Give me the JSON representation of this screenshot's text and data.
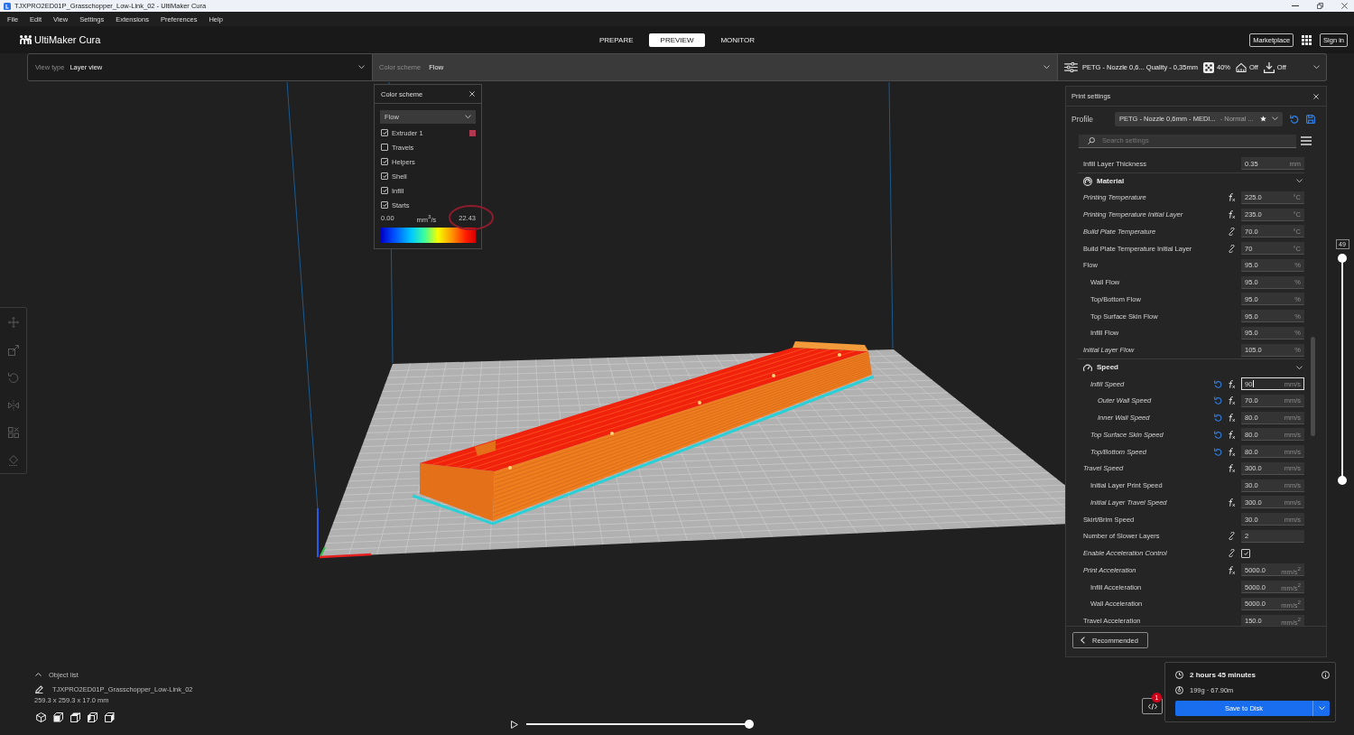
{
  "window": {
    "title": "TJXPRO2ED01P_Grasschopper_Low-Link_02 - UltiMaker Cura"
  },
  "menu": [
    "File",
    "Edit",
    "View",
    "Settings",
    "Extensions",
    "Preferences",
    "Help"
  ],
  "header": {
    "logo": "UltiMaker Cura",
    "stages": [
      {
        "label": "PREPARE",
        "selected": false
      },
      {
        "label": "PREVIEW",
        "selected": true
      },
      {
        "label": "MONITOR",
        "selected": false
      }
    ],
    "marketplace": "Marketplace",
    "sign_in": "Sign in"
  },
  "view_bar": {
    "view_type": {
      "label": "View type",
      "value": "Layer view"
    },
    "color_scheme": {
      "label": "Color scheme",
      "value": "Flow"
    },
    "print_setup": {
      "profile": "PETG - Nozzle 0,6... Quality - 0,35mm",
      "infill": "40%",
      "support": "Off",
      "adhesion": "Off"
    }
  },
  "color_scheme_panel": {
    "title": "Color scheme",
    "scheme": "Flow",
    "options": [
      {
        "label": "Extruder 1",
        "checked": true,
        "color": "#b0384f"
      },
      {
        "label": "Travels",
        "checked": false
      },
      {
        "label": "Helpers",
        "checked": true
      },
      {
        "label": "Shell",
        "checked": true
      },
      {
        "label": "Infill",
        "checked": true
      },
      {
        "label": "Starts",
        "checked": true
      }
    ],
    "legend": {
      "min": "0.00",
      "unit": "mm$^{3}$/s",
      "max": "22.43",
      "max_circled": true
    }
  },
  "tools": [
    {
      "kind": "move",
      "disabled": true
    },
    {
      "kind": "scale",
      "disabled": true
    },
    {
      "kind": "rotate",
      "disabled": true
    },
    {
      "kind": "mirror",
      "disabled": true
    },
    {
      "kind": "permodel",
      "disabled": true
    },
    {
      "kind": "blocker",
      "disabled": true
    }
  ],
  "print_settings": {
    "title": "Print settings",
    "profile_label": "Profile",
    "profile": "PETG - Nozzle 0,6mm - MEDI...",
    "profile_quality": "- Normal ...",
    "search_placeholder": "Search settings",
    "items": [
      {
        "kind": "setting",
        "label": "Infill Layer Thickness",
        "inherited": false,
        "modified": false,
        "formula": false,
        "linked": false,
        "value": "0.35",
        "unit": "mm",
        "focused": false
      },
      {
        "kind": "category",
        "label": "Material",
        "expanded": true,
        "children": [
          {
            "kind": "setting",
            "label": "Printing Temperature",
            "inherited": true,
            "modified": false,
            "formula": true,
            "linked": false,
            "value": "225.0",
            "unit": "°C",
            "focused": false
          },
          {
            "kind": "setting",
            "label": "Printing Temperature Initial Layer",
            "inherited": true,
            "modified": false,
            "formula": true,
            "linked": false,
            "value": "235.0",
            "unit": "°C",
            "focused": false
          },
          {
            "kind": "setting",
            "label": "Build Plate Temperature",
            "inherited": true,
            "modified": false,
            "formula": false,
            "linked": true,
            "value": "70.0",
            "unit": "°C",
            "focused": false
          },
          {
            "kind": "setting",
            "label": "Build Plate Temperature Initial Layer",
            "inherited": false,
            "modified": false,
            "formula": false,
            "linked": true,
            "value": "70",
            "unit": "°C",
            "focused": false
          },
          {
            "kind": "setting",
            "label": "Flow",
            "inherited": false,
            "modified": false,
            "formula": false,
            "linked": false,
            "value": "95.0",
            "unit": "%",
            "focused": false,
            "children": [
              {
                "kind": "setting",
                "label": "Wall Flow",
                "inherited": false,
                "modified": false,
                "formula": false,
                "linked": false,
                "value": "95.0",
                "unit": "%",
                "focused": false
              },
              {
                "kind": "setting",
                "label": "Top/Bottom Flow",
                "inherited": false,
                "modified": false,
                "formula": false,
                "linked": false,
                "value": "95.0",
                "unit": "%",
                "focused": false
              },
              {
                "kind": "setting",
                "label": "Top Surface Skin Flow",
                "inherited": false,
                "modified": false,
                "formula": false,
                "linked": false,
                "value": "95.0",
                "unit": "%",
                "focused": false
              },
              {
                "kind": "setting",
                "label": "Infill Flow",
                "inherited": false,
                "modified": false,
                "formula": false,
                "linked": false,
                "value": "95.0",
                "unit": "%",
                "focused": false
              }
            ]
          },
          {
            "kind": "setting",
            "label": "Initial Layer Flow",
            "inherited": true,
            "modified": false,
            "formula": false,
            "linked": false,
            "value": "105.0",
            "unit": "%",
            "focused": false
          }
        ]
      },
      {
        "kind": "category",
        "label": "Speed",
        "expanded": true,
        "children": [
          {
            "kind": "group",
            "children": [
              {
                "kind": "setting",
                "label": "Infill Speed",
                "inherited": true,
                "modified": true,
                "formula": true,
                "linked": false,
                "value": "90",
                "unit": "mm/s",
                "focused": true
              },
              {
                "kind": "group",
                "children": [
                  {
                    "kind": "setting",
                    "label": "Outer Wall Speed",
                    "inherited": true,
                    "modified": true,
                    "formula": true,
                    "linked": false,
                    "value": "70.0",
                    "unit": "mm/s",
                    "focused": false
                  },
                  {
                    "kind": "setting",
                    "label": "Inner Wall Speed",
                    "inherited": true,
                    "modified": true,
                    "formula": true,
                    "linked": false,
                    "value": "80.0",
                    "unit": "mm/s",
                    "focused": false
                  }
                ]
              },
              {
                "kind": "setting",
                "label": "Top Surface Skin Speed",
                "inherited": true,
                "modified": true,
                "formula": true,
                "linked": false,
                "value": "80.0",
                "unit": "mm/s",
                "focused": false
              },
              {
                "kind": "setting",
                "label": "Top/Bottom Speed",
                "inherited": true,
                "modified": true,
                "formula": true,
                "linked": false,
                "value": "80.0",
                "unit": "mm/s",
                "focused": false
              }
            ]
          },
          {
            "kind": "setting",
            "label": "Travel Speed",
            "inherited": true,
            "modified": false,
            "formula": true,
            "linked": false,
            "value": "300.0",
            "unit": "mm/s",
            "focused": false
          },
          {
            "kind": "group",
            "children": [
              {
                "kind": "setting",
                "label": "Initial Layer Print Speed",
                "inherited": false,
                "modified": false,
                "formula": false,
                "linked": false,
                "value": "30.0",
                "unit": "mm/s",
                "focused": false
              },
              {
                "kind": "setting",
                "label": "Initial Layer Travel Speed",
                "inherited": true,
                "modified": false,
                "formula": true,
                "linked": false,
                "value": "300.0",
                "unit": "mm/s",
                "focused": false
              }
            ]
          },
          {
            "kind": "setting",
            "label": "Skirt/Brim Speed",
            "inherited": false,
            "modified": false,
            "formula": false,
            "linked": false,
            "value": "30.0",
            "unit": "mm/s",
            "focused": false
          },
          {
            "kind": "setting",
            "label": "Number of Slower Layers",
            "inherited": false,
            "modified": false,
            "formula": false,
            "linked": true,
            "value": "2",
            "focused": false
          },
          {
            "kind": "checkbox",
            "label": "Enable Acceleration Control",
            "inherited": true,
            "modified": false,
            "formula": false,
            "linked": true,
            "checked": true
          },
          {
            "kind": "setting",
            "label": "Print Acceleration",
            "inherited": true,
            "modified": false,
            "formula": true,
            "linked": false,
            "value": "5000.0",
            "unit": "mm/s$^{2}$",
            "focused": false,
            "children": [
              {
                "kind": "setting",
                "label": "Infill Acceleration",
                "inherited": false,
                "modified": false,
                "formula": false,
                "linked": false,
                "value": "5000.0",
                "unit": "mm/s$^{2}$",
                "focused": false
              },
              {
                "kind": "setting",
                "label": "Wall Acceleration",
                "inherited": false,
                "modified": false,
                "formula": false,
                "linked": false,
                "value": "5000.0",
                "unit": "mm/s$^{2}$",
                "focused": false
              }
            ]
          },
          {
            "kind": "setting",
            "label": "Travel Acceleration",
            "inherited": false,
            "modified": false,
            "formula": false,
            "linked": false,
            "value": "150.0",
            "unit": "mm/s$^{2}$",
            "focused": false
          }
        ]
      }
    ],
    "recommended": "Recommended"
  },
  "layer_slider": {
    "label": "49",
    "top_handle": {
      "level": 1
    },
    "bottom_handle": {
      "level": 0
    }
  },
  "object_list": {
    "title": "Object list",
    "object": "TJXPRO2ED01P_Grasschopper_Low-Link_02",
    "dimensions": "259.3 x 259.3 x 17.0 mm",
    "views": [
      {
        "kind": "perspective"
      },
      {
        "kind": "front"
      },
      {
        "kind": "top"
      },
      {
        "kind": "left"
      },
      {
        "kind": "right"
      }
    ]
  },
  "playback": {
    "level": 1
  },
  "notifications": {
    "badge": "1"
  },
  "print_info": {
    "time": "2 hours 45 minutes",
    "material": "199g · 67.90m",
    "action": "Save to Disk"
  }
}
